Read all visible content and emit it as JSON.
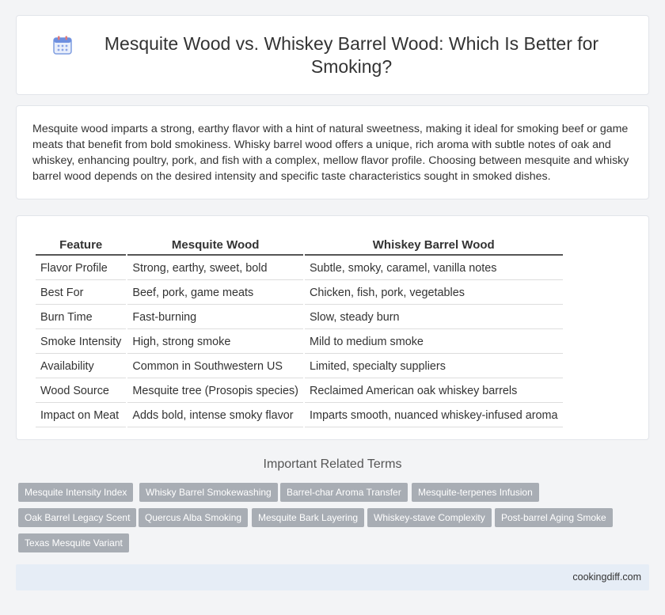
{
  "header": {
    "icon": "calendar-icon",
    "title": "Mesquite Wood vs. Whiskey Barrel Wood: Which Is Better for Smoking?"
  },
  "intro": {
    "text": "Mesquite wood imparts a strong, earthy flavor with a hint of natural sweetness, making it ideal for smoking beef or game meats that benefit from bold smokiness. Whisky barrel wood offers a unique, rich aroma with subtle notes of oak and whiskey, enhancing poultry, pork, and fish with a complex, mellow flavor profile. Choosing between mesquite and whisky barrel wood depends on the desired intensity and specific taste characteristics sought in smoked dishes."
  },
  "table": {
    "headers": [
      "Feature",
      "Mesquite Wood",
      "Whiskey Barrel Wood"
    ],
    "rows": [
      [
        "Flavor Profile",
        "Strong, earthy, sweet, bold",
        "Subtle, smoky, caramel, vanilla notes"
      ],
      [
        "Best For",
        "Beef, pork, game meats",
        "Chicken, fish, pork, vegetables"
      ],
      [
        "Burn Time",
        "Fast-burning",
        "Slow, steady burn"
      ],
      [
        "Smoke Intensity",
        "High, strong smoke",
        "Mild to medium smoke"
      ],
      [
        "Availability",
        "Common in Southwestern US",
        "Limited, specialty suppliers"
      ],
      [
        "Wood Source",
        "Mesquite tree (Prosopis species)",
        "Reclaimed American oak whiskey barrels"
      ],
      [
        "Impact on Meat",
        "Adds bold, intense smoky flavor",
        "Imparts smooth, nuanced whiskey-infused aroma"
      ]
    ]
  },
  "related": {
    "title": "Important Related Terms",
    "tags": [
      "Mesquite Intensity Index",
      "Whisky Barrel Smokewashing",
      "Barrel-char Aroma Transfer",
      "Mesquite-terpenes Infusion",
      "Oak Barrel Legacy Scent",
      "Quercus Alba Smoking",
      "Mesquite Bark Layering",
      "Whiskey-stave Complexity",
      "Post-barrel Aging Smoke",
      "Texas Mesquite Variant"
    ]
  },
  "footer": {
    "site": "cookingdiff.com"
  }
}
